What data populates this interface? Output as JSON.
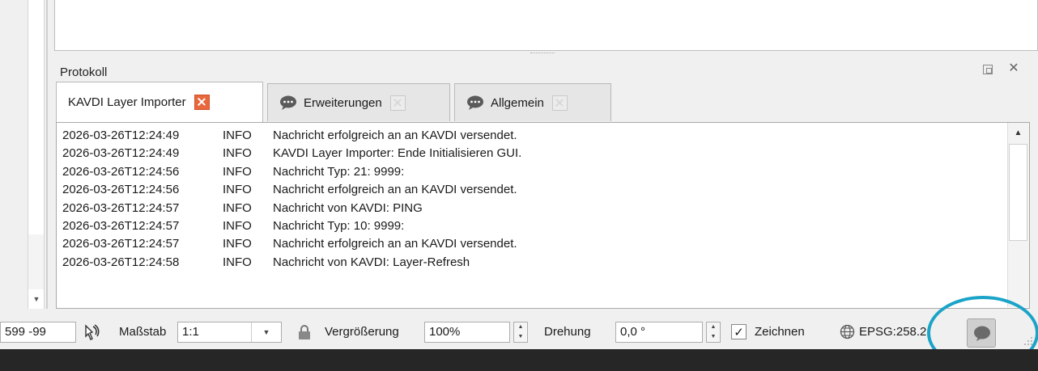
{
  "dock": {
    "title": "Protokoll"
  },
  "tabs": [
    {
      "label": "KAVDI Layer Importer",
      "icon": null,
      "active": true
    },
    {
      "label": "Erweiterungen",
      "icon": "speech-bubble-icon",
      "active": false
    },
    {
      "label": "Allgemein",
      "icon": "speech-bubble-icon",
      "active": false
    }
  ],
  "log": [
    {
      "ts": "2026-03-26T12:24:49",
      "level": "INFO",
      "msg": "Nachricht erfolgreich an an KAVDI versendet."
    },
    {
      "ts": "2026-03-26T12:24:49",
      "level": "INFO",
      "msg": "KAVDI Layer Importer: Ende Initialisieren GUI."
    },
    {
      "ts": "2026-03-26T12:24:56",
      "level": "INFO",
      "msg": "Nachricht Typ: 21: 9999:"
    },
    {
      "ts": "2026-03-26T12:24:56",
      "level": "INFO",
      "msg": "Nachricht erfolgreich an an KAVDI versendet."
    },
    {
      "ts": "2026-03-26T12:24:57",
      "level": "INFO",
      "msg": "Nachricht von KAVDI: PING"
    },
    {
      "ts": "2026-03-26T12:24:57",
      "level": "INFO",
      "msg": "Nachricht Typ: 10: 9999:"
    },
    {
      "ts": "2026-03-26T12:24:57",
      "level": "INFO",
      "msg": "Nachricht erfolgreich an an KAVDI versendet."
    },
    {
      "ts": "2026-03-26T12:24:58",
      "level": "INFO",
      "msg": "Nachricht von KAVDI: Layer-Refresh"
    }
  ],
  "status": {
    "coordinate": "599 -99",
    "scale_label": "Maßstab",
    "scale_value": "1:1",
    "magnifier_label": "Vergrößerung",
    "magnifier_value": "100%",
    "rotation_label": "Drehung",
    "rotation_value": "0,0 °",
    "render_label": "Zeichnen",
    "render_checked": true,
    "crs": "EPSG:258.2"
  },
  "colors": {
    "accent_highlight": "#1aa4c8",
    "tab_close_active": "#e9673d"
  }
}
